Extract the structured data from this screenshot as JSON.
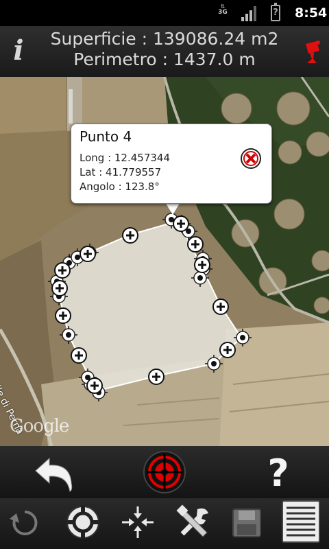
{
  "status_bar": {
    "network": "3G",
    "clock": "8:54"
  },
  "header": {
    "area_text": "Superficie : 139086.24 m2",
    "perimeter_text": "Perimetro : 1437.0 m",
    "info_glyph": "i"
  },
  "map": {
    "road_label": "Valle di Perna",
    "attribution": "Google"
  },
  "popup": {
    "title": "Punto 4",
    "long": "Long : 12.457344",
    "lat": "Lat : 41.779557",
    "angle": "Angolo : 123.8°"
  },
  "toolbar_top": {
    "undo": "undo-icon",
    "target": "crosshair-target-icon",
    "help": "?"
  },
  "toolbar_bottom": [
    "refresh-icon",
    "locate-icon",
    "move-point-icon",
    "tools-icon",
    "save-icon",
    "list-icon"
  ],
  "colors": {
    "accent_red": "#d40000",
    "bar_bg": "#1e1e1e",
    "text_light": "#dadada"
  }
}
